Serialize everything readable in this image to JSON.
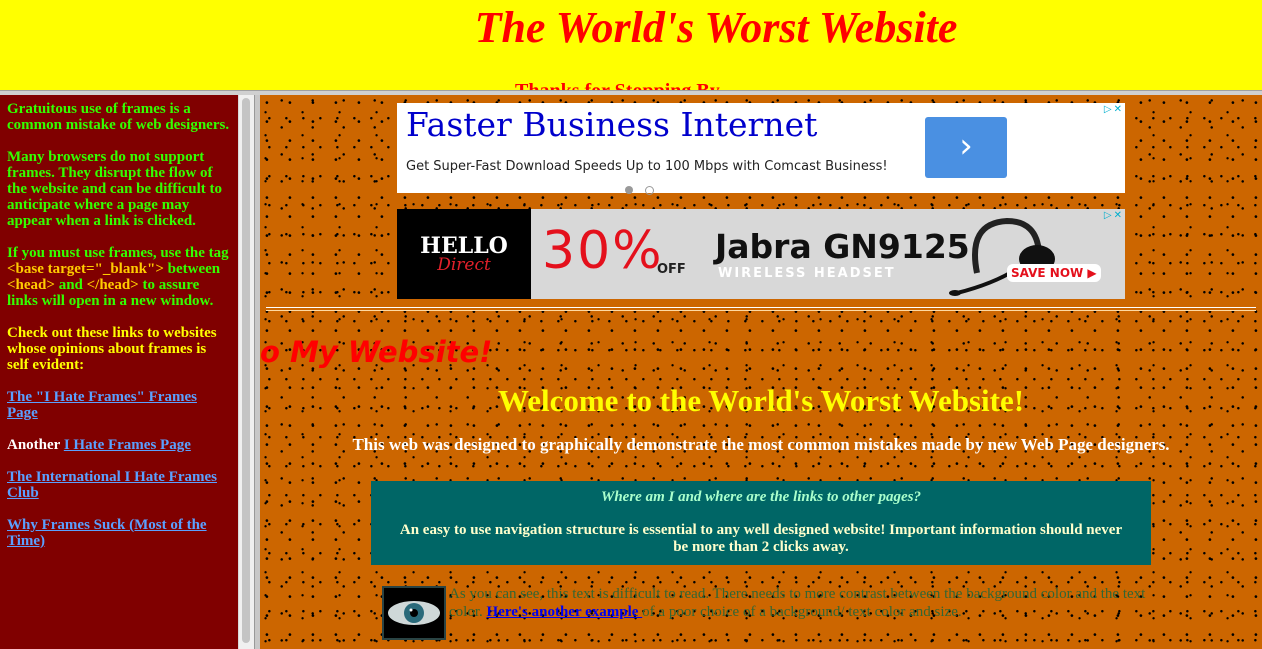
{
  "header": {
    "title": "The World's Worst Website",
    "partial_subtitle": "Thanks for Stopping By"
  },
  "sidebar": {
    "para1": "Gratuitous use of frames is a common mistake of web designers.",
    "para2": "Many browsers do not support frames. They disrupt the flow of the website and can be difficult to anticipate where a page may appear when a link is clicked.",
    "para3_a": "If you must use frames, use the tag ",
    "para3_tag1": "<base target=\"_blank\">",
    "para3_b": " between ",
    "para3_tag2": "<head>",
    "para3_c": " and ",
    "para3_tag3": "</head>",
    "para3_d": " to assure links will open in a new window.",
    "para4": "Check out these links to websites whose opinions about frames is self evident:",
    "link1": "The \"I Hate Frames\" Frames Page",
    "link2_prefix": "Another ",
    "link2": "I Hate Frames Page",
    "link3": "The International I Hate Frames Club",
    "link4": "Why Frames Suck (Most of the Time)"
  },
  "ads": {
    "ad1": {
      "title": "Faster Business Internet",
      "subtitle": "Get Super-Fast Download Speeds Up to 100 Mbps with Comcast Business!",
      "button_icon": "chevron-right-icon",
      "button_glyph": "›"
    },
    "ad2": {
      "logo_line1": "HELLO",
      "logo_line2": "Direct",
      "discount": "30%",
      "off": "OFF",
      "product": "Jabra GN9125",
      "product_sub": "WIRELESS HEADSET",
      "cta": "SAVE NOW ▶"
    },
    "close_glyphs": "▷✕"
  },
  "main": {
    "marquee_fragment": "o My Website!",
    "welcome": "Welcome to the World's Worst Website!",
    "intro": "This web was designed to graphically demonstrate the most common mistakes made by new Web Page designers.",
    "nav_question": "Where am I and where are the links to other pages?",
    "nav_answer": "An easy to use navigation structure is essential to any well designed website! Important information should never be more than 2 clicks away.",
    "low_text_a": "As you can see, this text is difficult to read. There needs to more contrast between the background color and the text color. ",
    "low_link": "Here's another example ",
    "low_text_b": "of a poor choice of a background/ text color and size."
  },
  "colors": {
    "header_bg": "#ffff00",
    "title_red": "#ff0000",
    "sidebar_bg": "#800000",
    "main_bg": "#cc6600",
    "nav_box": "#006666"
  }
}
